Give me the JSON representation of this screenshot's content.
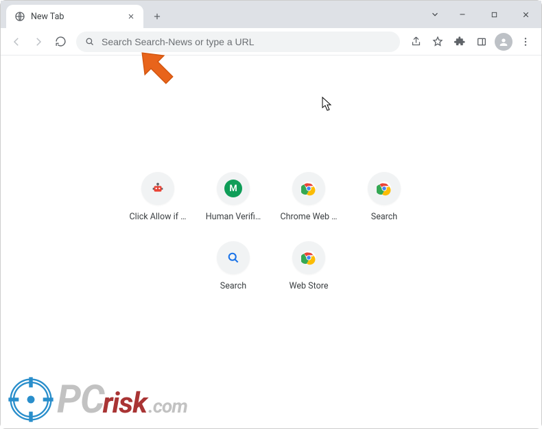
{
  "window": {
    "tab_title": "New Tab"
  },
  "omnibox": {
    "placeholder": "Search Search-News or type a URL",
    "value": ""
  },
  "shortcuts": [
    {
      "label": "Click Allow if …",
      "icon": "robot"
    },
    {
      "label": "Human Verifi…",
      "icon": "letter",
      "letter": "M",
      "bg": "#0f9d58"
    },
    {
      "label": "Chrome Web …",
      "icon": "chrome"
    },
    {
      "label": "Search",
      "icon": "chrome"
    },
    {
      "label": "Search",
      "icon": "search"
    },
    {
      "label": "Web Store",
      "icon": "chrome"
    }
  ],
  "watermark": {
    "part1": "PC",
    "part2": "risk",
    "part3": ".com"
  }
}
